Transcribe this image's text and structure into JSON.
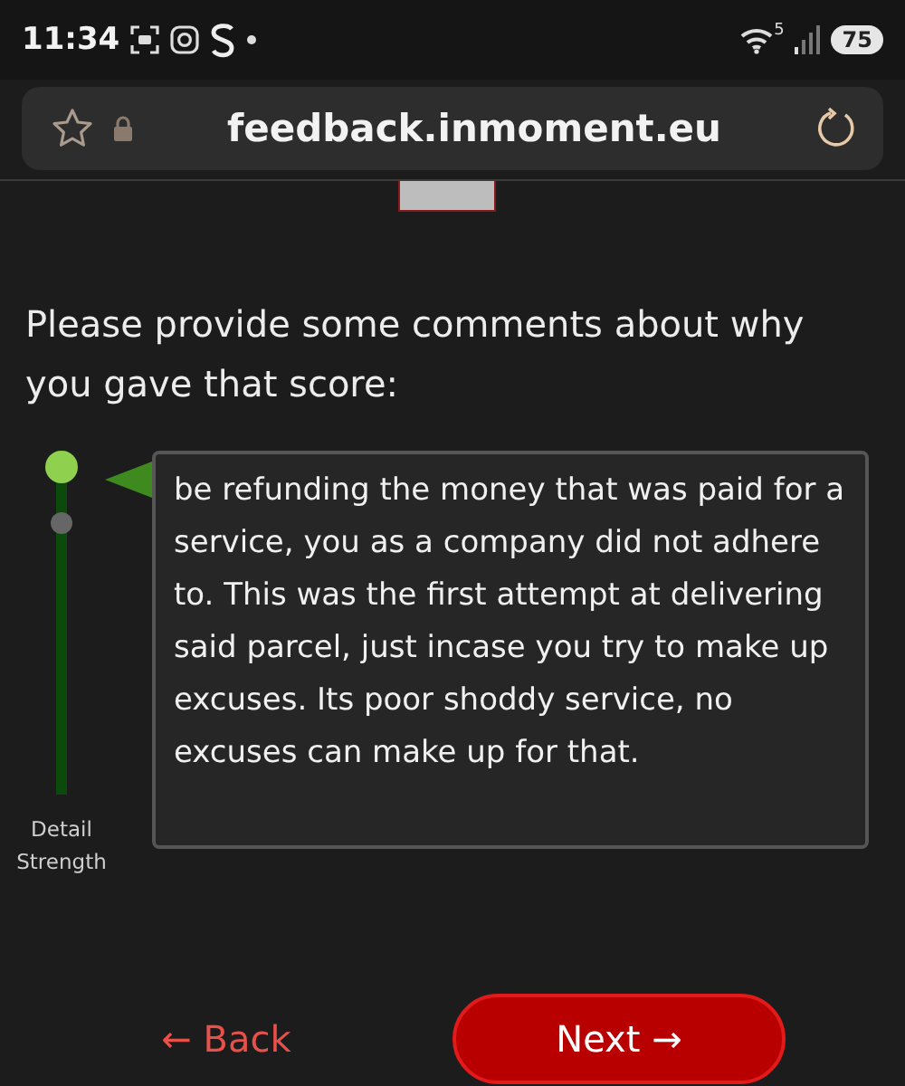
{
  "status_bar": {
    "time": "11:34",
    "network": "5",
    "battery": "75"
  },
  "address_bar": {
    "url": "feedback.inmoment.eu"
  },
  "question": "Please provide some comments about why you gave that score:",
  "slider": {
    "label": "Detail Strength",
    "level": 1
  },
  "comment": {
    "value": "be refunding the money that was paid for a service, you as a company did not adhere to. This was the first attempt at delivering said parcel, just incase you try to make up excuses. Its poor shoddy service, no excuses can make up  for that."
  },
  "buttons": [
    {
      "kind": "link",
      "label": "← Back"
    },
    {
      "kind": "primary",
      "label": "Next →"
    }
  ]
}
